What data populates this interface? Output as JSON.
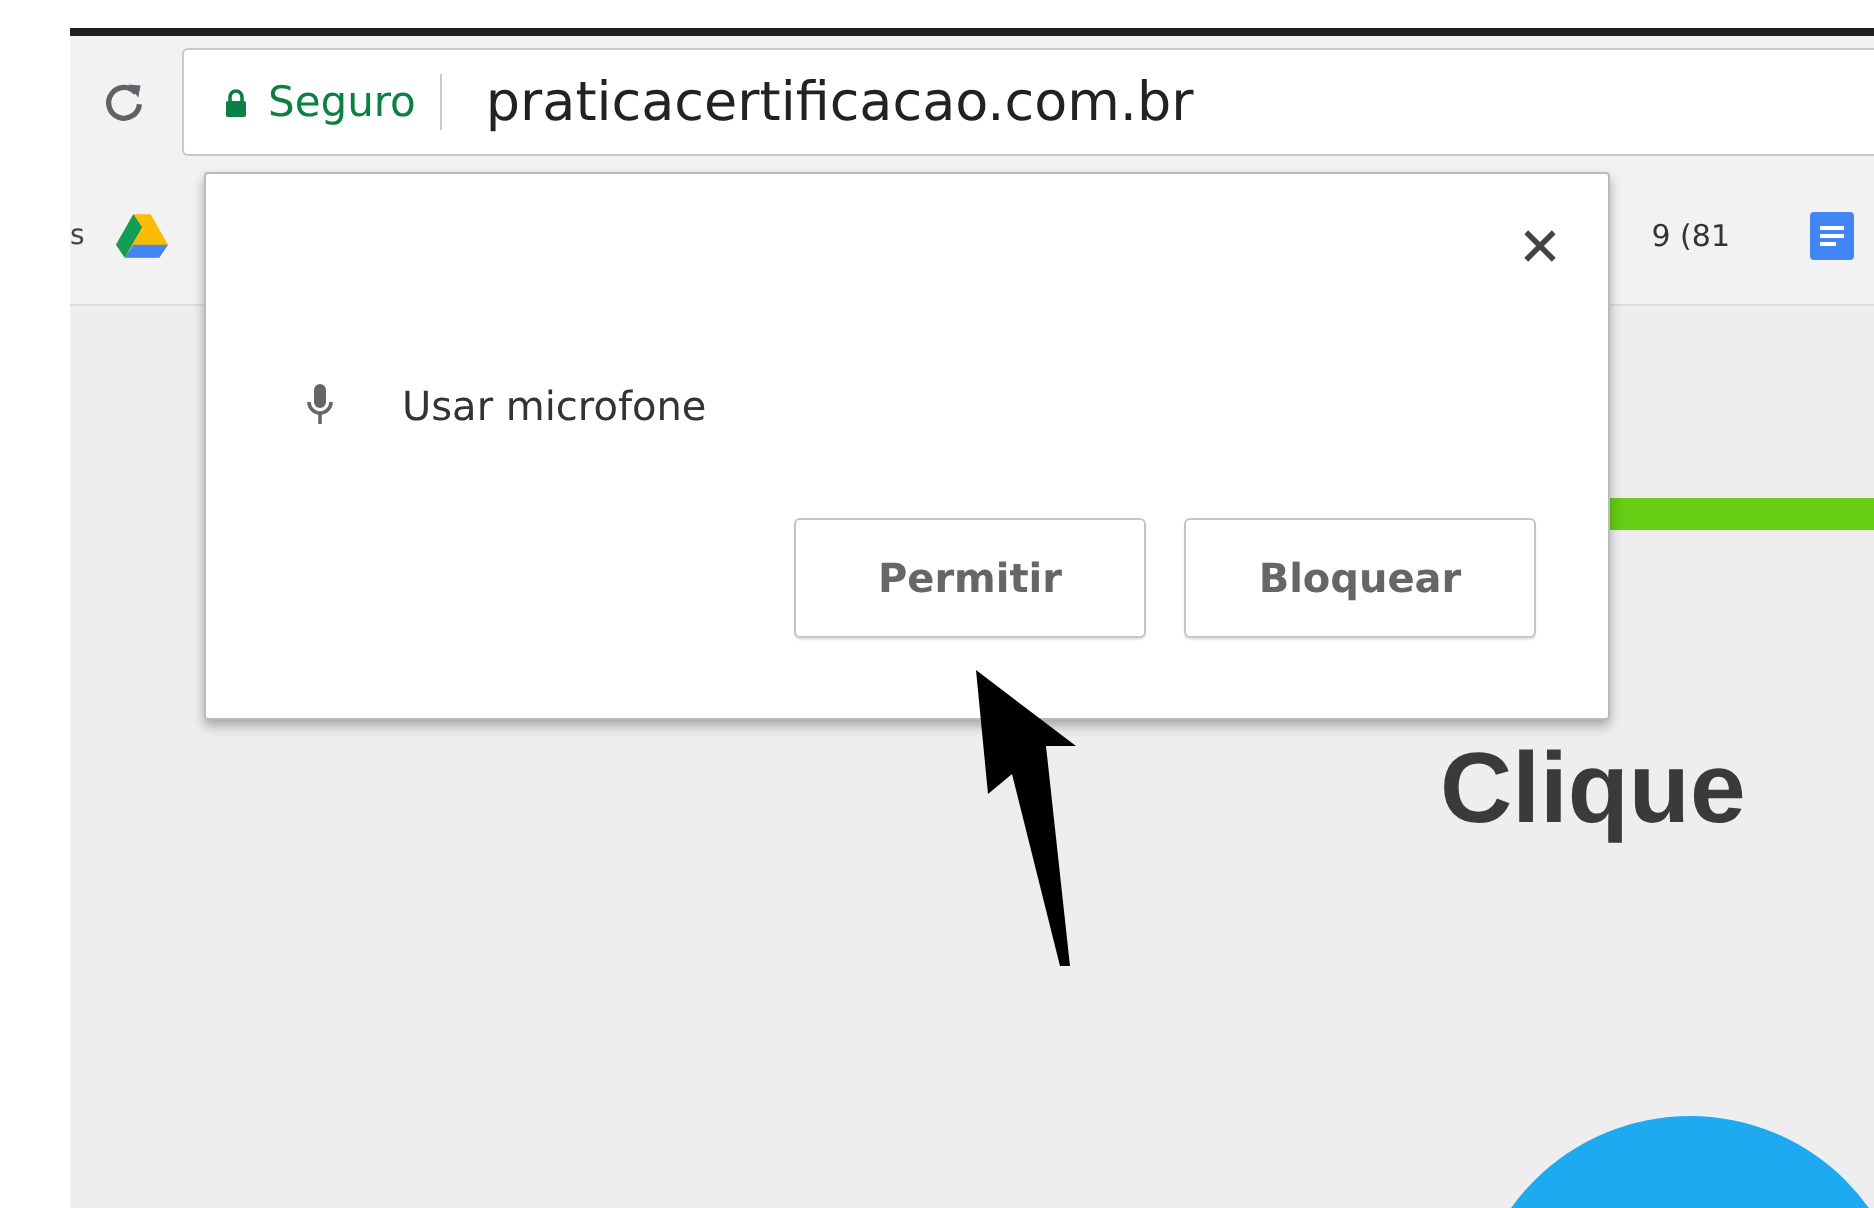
{
  "address_bar": {
    "security_label": "Seguro",
    "url": "praticacertificacao.com.br"
  },
  "bookmarks_bar": {
    "left_text": "s",
    "right_text": "9 (81"
  },
  "permission_popup": {
    "permission": "Usar microfone",
    "buttons": [
      "Permitir",
      "Bloquear"
    ]
  },
  "page": {
    "heading": "Clique"
  }
}
